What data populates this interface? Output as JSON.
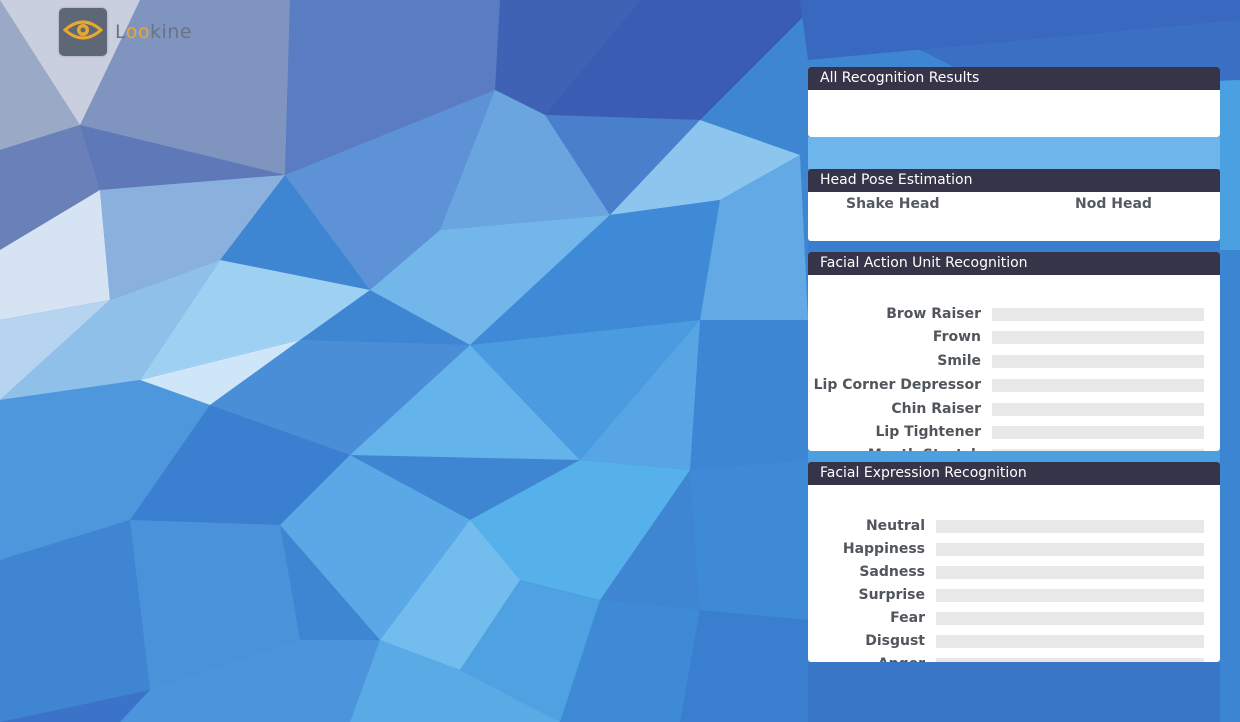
{
  "app": {
    "logo_text_a": "L",
    "logo_text_b": "oo",
    "logo_text_c": "kine",
    "logo_icon": "eye-icon",
    "accent_color": "#e8a830"
  },
  "panels": {
    "all_results": {
      "title": "All Recognition Results",
      "content": ""
    },
    "head_pose": {
      "title": "Head Pose Estimation",
      "shake_label": "Shake Head",
      "nod_label": "Nod Head"
    },
    "action_units": {
      "title": "Facial Action Unit Recognition",
      "items": [
        {
          "label": "Brow Raiser",
          "level": 0
        },
        {
          "label": "Frown",
          "level": 0
        },
        {
          "label": "Smile",
          "level": 0
        },
        {
          "label": "Lip Corner Depressor",
          "level": 0
        },
        {
          "label": "Chin Raiser",
          "level": 0
        },
        {
          "label": "Lip Tightener",
          "level": 0
        },
        {
          "label": "Mouth Stretch",
          "level": 0
        }
      ]
    },
    "expressions": {
      "title": "Facial Expression Recognition",
      "items": [
        {
          "label": "Neutral",
          "level": 0
        },
        {
          "label": "Happiness",
          "level": 0
        },
        {
          "label": "Sadness",
          "level": 0
        },
        {
          "label": "Surprise",
          "level": 0
        },
        {
          "label": "Fear",
          "level": 0
        },
        {
          "label": "Disgust",
          "level": 0
        },
        {
          "label": "Anger",
          "level": 0
        }
      ]
    }
  },
  "colors": {
    "panel_header": "#363448",
    "bar_track": "#e8e8e8",
    "bar_fill": "#4a90d9"
  }
}
